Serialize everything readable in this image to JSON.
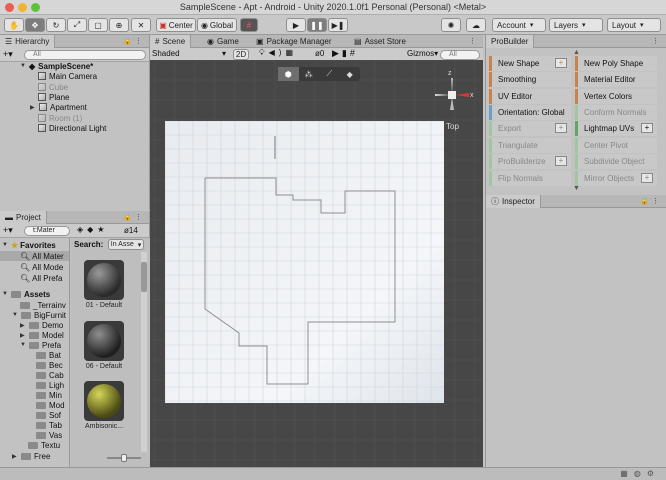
{
  "window": {
    "title": "SampleScene - Apt - Android - Unity 2020.1.0f1 Personal (Personal) <Metal>"
  },
  "toolbar": {
    "pivot_label": "Center",
    "space_label": "Global",
    "account_label": "Account",
    "layers_label": "Layers",
    "layout_label": "Layout"
  },
  "hierarchy": {
    "tab_label": "Hierarchy",
    "search_placeholder": "All",
    "items": [
      {
        "label": "SampleScene*"
      },
      {
        "label": "Main Camera"
      },
      {
        "label": "Cube"
      },
      {
        "label": "Plane"
      },
      {
        "label": "Apartment"
      },
      {
        "label": "Room (1)"
      },
      {
        "label": "Directional Light"
      }
    ]
  },
  "scene": {
    "tabs": [
      "Scene",
      "Game",
      "Package Manager",
      "Asset Store"
    ],
    "shading_label": "Shaded",
    "mode_2d_label": "2D",
    "gizmos_label": "Gizmos",
    "gizmo_count": "0",
    "search_placeholder": "All",
    "view_label": "Top"
  },
  "probuilder": {
    "tab_label": "ProBuilder",
    "left": [
      {
        "label": "New Shape"
      },
      {
        "label": "Smoothing"
      },
      {
        "label": "UV Editor"
      },
      {
        "label": "Orientation: Global"
      },
      {
        "label": "Export"
      },
      {
        "label": "Triangulate"
      },
      {
        "label": "ProBuilderize"
      },
      {
        "label": "Flip Normals"
      }
    ],
    "right": [
      {
        "label": "New Poly Shape"
      },
      {
        "label": "Material Editor"
      },
      {
        "label": "Vertex Colors"
      },
      {
        "label": "Conform Normals"
      },
      {
        "label": "Lightmap UVs"
      },
      {
        "label": "Center Pivot"
      },
      {
        "label": "Subdivide Object"
      },
      {
        "label": "Mirror Objects"
      }
    ]
  },
  "inspector": {
    "tab_label": "Inspector"
  },
  "project": {
    "tab_label": "Project",
    "search_value": "t:Mater",
    "hidden_count": "14",
    "search_label": "Search:",
    "search_scope": "In Asse",
    "favorites_label": "Favorites",
    "favorites": [
      {
        "label": "All Mater"
      },
      {
        "label": "All Mode"
      },
      {
        "label": "All Prefa"
      }
    ],
    "assets_label": "Assets",
    "assets": [
      {
        "label": "_Terrainv"
      },
      {
        "label": "BigFurnit"
      },
      {
        "label": "Demo"
      },
      {
        "label": "Model"
      },
      {
        "label": "Prefa"
      },
      {
        "label": "Bat"
      },
      {
        "label": "Bec"
      },
      {
        "label": "Cab"
      },
      {
        "label": "Ligh"
      },
      {
        "label": "Min"
      },
      {
        "label": "Mod"
      },
      {
        "label": "Sof"
      },
      {
        "label": "Tab"
      },
      {
        "label": "Vas"
      },
      {
        "label": "Textu"
      },
      {
        "label": "Free"
      }
    ],
    "materials": [
      {
        "label": "01 - Default",
        "color": "#3c3c3c"
      },
      {
        "label": "06 - Default",
        "color": "#3a3a3a"
      },
      {
        "label": "Ambisonic...",
        "color": "#7d7d1e"
      }
    ]
  }
}
